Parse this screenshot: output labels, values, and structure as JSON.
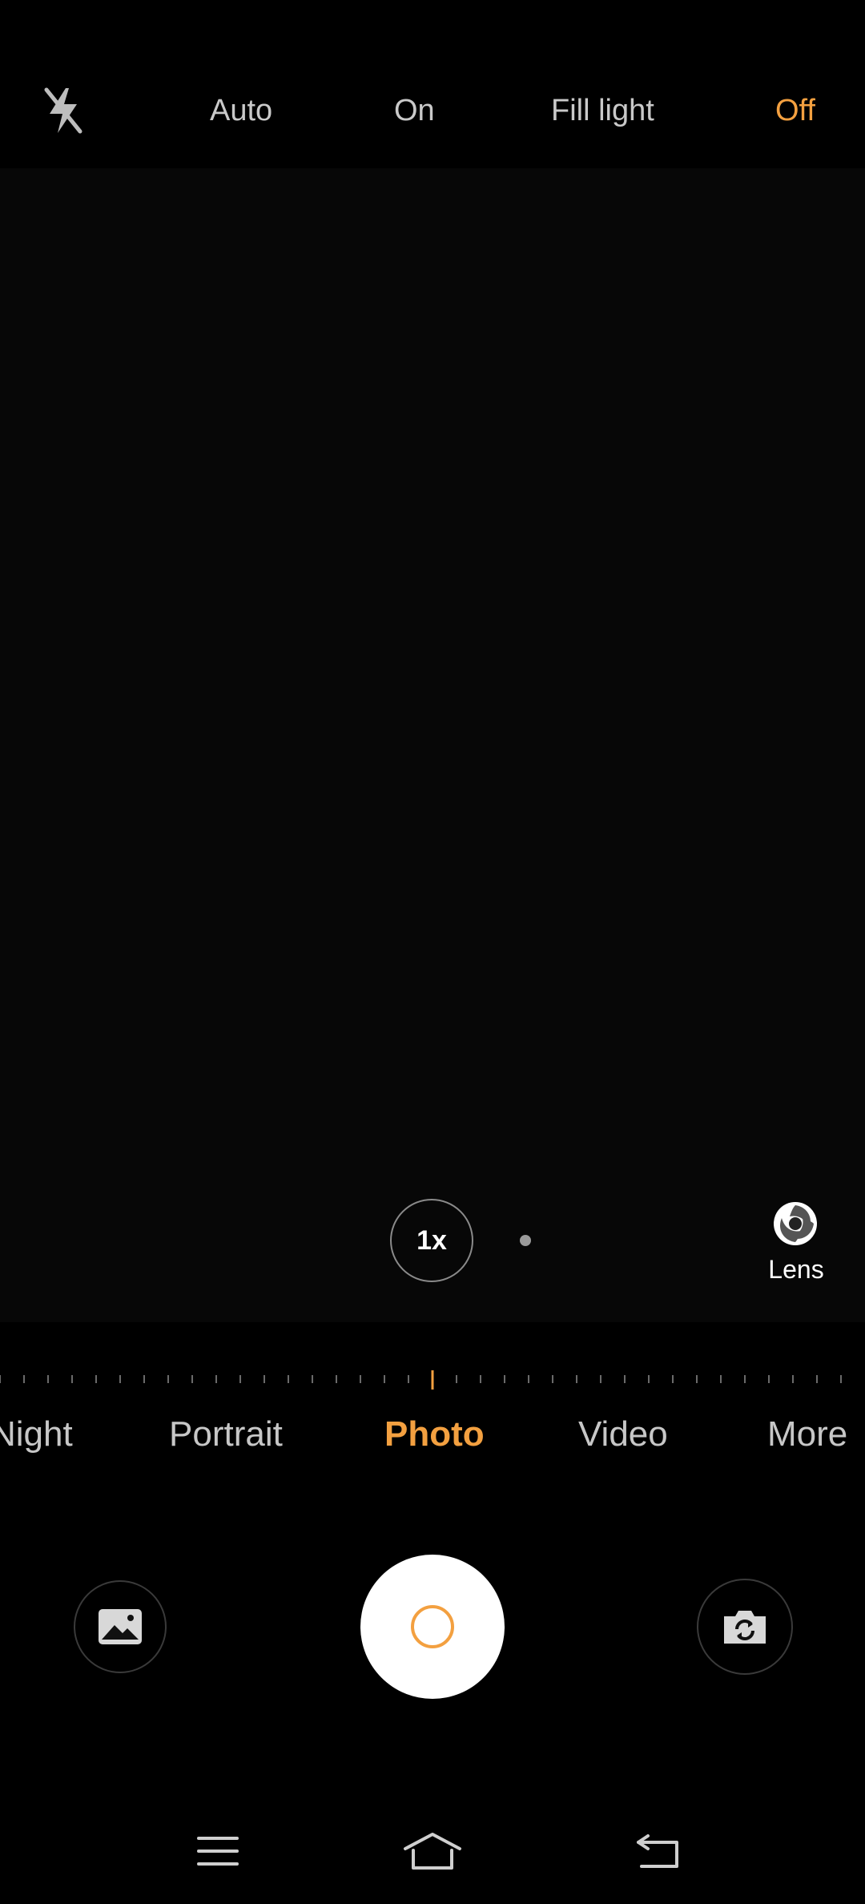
{
  "flash_bar": {
    "options": [
      {
        "label": "Auto",
        "active": false
      },
      {
        "label": "On",
        "active": false
      },
      {
        "label": "Fill light",
        "active": false
      },
      {
        "label": "Off",
        "active": true
      }
    ],
    "icon": "flash-off-icon"
  },
  "zoom": {
    "label": "1x"
  },
  "lens": {
    "label": "Lens",
    "icon": "lens-icon"
  },
  "modes": [
    {
      "label": "Night",
      "active": false
    },
    {
      "label": "Portrait",
      "active": false
    },
    {
      "label": "Photo",
      "active": true
    },
    {
      "label": "Video",
      "active": false
    },
    {
      "label": "More",
      "active": false
    }
  ],
  "controls": {
    "gallery_icon": "gallery-icon",
    "shutter_icon": "shutter-icon",
    "switch_icon": "switch-camera-icon"
  },
  "nav": {
    "menu_icon": "menu-icon",
    "home_icon": "home-icon",
    "back_icon": "back-icon"
  },
  "colors": {
    "accent": "#f3a040",
    "text": "#c9c9c9",
    "background": "#000000"
  }
}
